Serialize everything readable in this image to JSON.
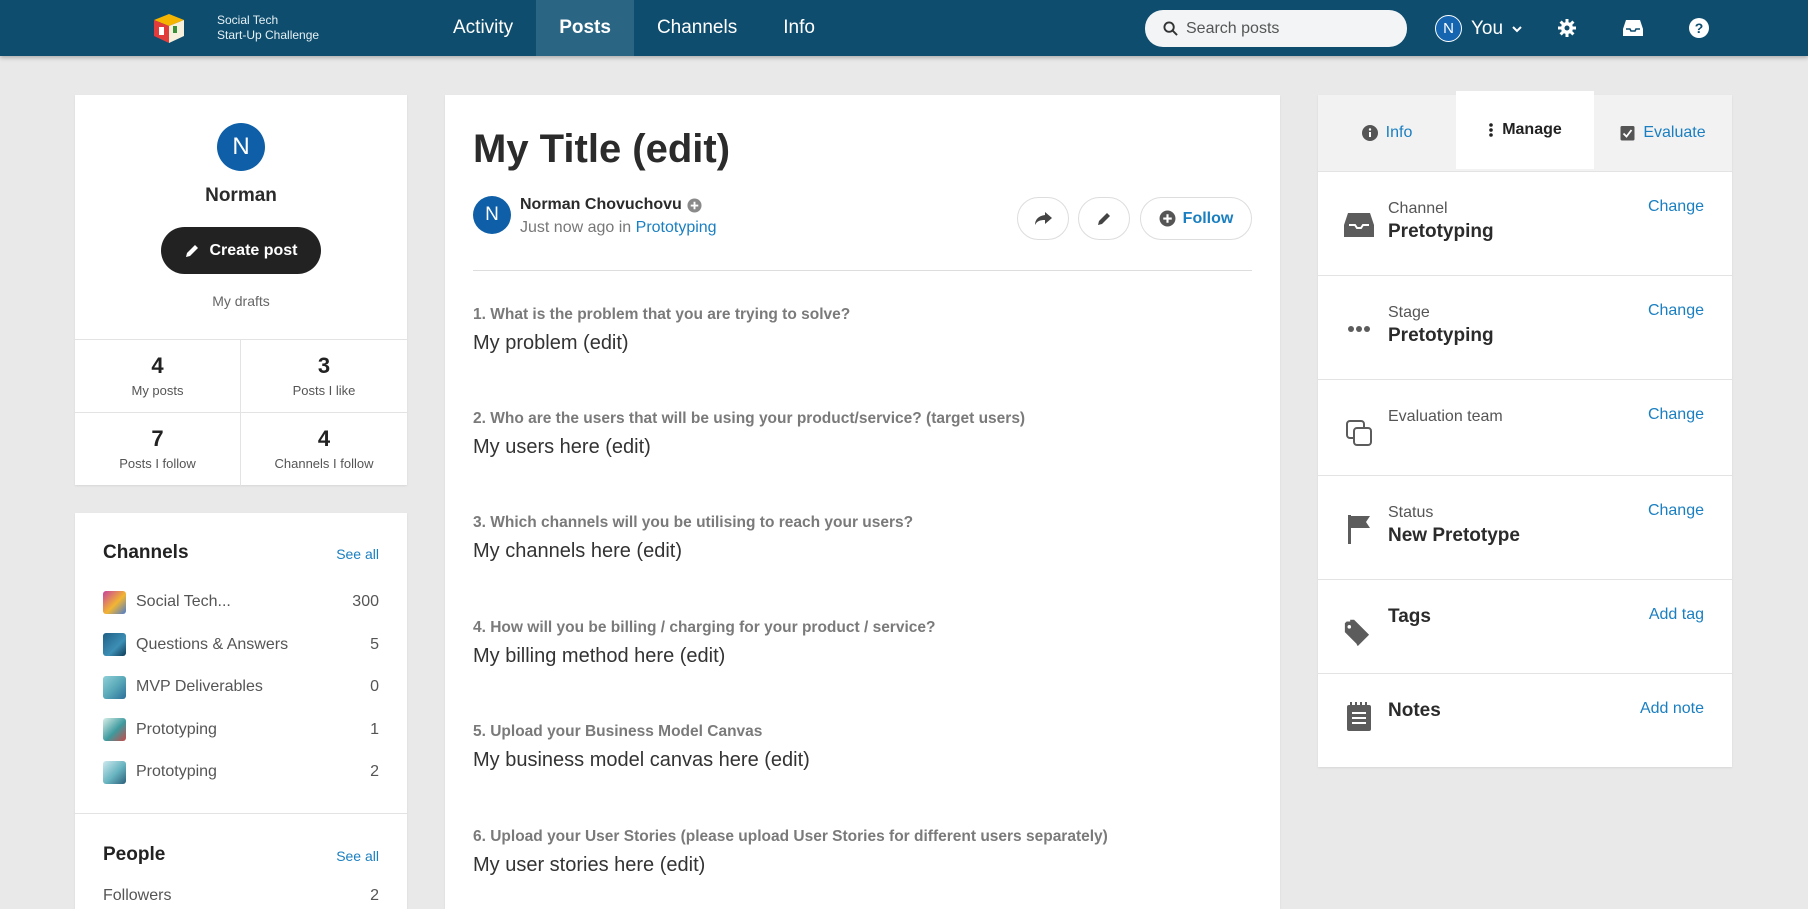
{
  "brand": {
    "line1": "Social Tech",
    "line2": "Start-Up Challenge"
  },
  "nav": [
    {
      "label": "Activity",
      "active": false
    },
    {
      "label": "Posts",
      "active": true
    },
    {
      "label": "Channels",
      "active": false
    },
    {
      "label": "Info",
      "active": false
    }
  ],
  "search": {
    "placeholder": "Search posts"
  },
  "user_menu": {
    "initial": "N",
    "label": "You"
  },
  "profile": {
    "initial": "N",
    "name": "Norman",
    "create_label": "Create post",
    "drafts_label": "My drafts",
    "stats": [
      {
        "value": "4",
        "label": "My posts"
      },
      {
        "value": "3",
        "label": "Posts I like"
      },
      {
        "value": "7",
        "label": "Posts I follow"
      },
      {
        "value": "4",
        "label": "Channels I follow"
      }
    ]
  },
  "channels": {
    "heading": "Channels",
    "see_all": "See all",
    "items": [
      {
        "name": "Social Tech...",
        "count": "300",
        "color": "#c83fa0"
      },
      {
        "name": "Questions & Answers",
        "count": "5",
        "color": "#1f5f86"
      },
      {
        "name": "MVP Deliverables",
        "count": "0",
        "color": "#5aa9b8"
      },
      {
        "name": "Prototyping",
        "count": "1",
        "color": "#3e9a9e"
      },
      {
        "name": "Prototyping",
        "count": "2",
        "color": "#67b3bf"
      }
    ]
  },
  "people": {
    "heading": "People",
    "see_all": "See all",
    "followers_label": "Followers",
    "followers_count": "2"
  },
  "post": {
    "title": "My Title (edit)",
    "author_initial": "N",
    "author": "Norman Chovuchovu",
    "time": "Just now ago",
    "in_label": "in",
    "channel": "Prototyping",
    "follow_label": "Follow",
    "sections": [
      {
        "q": "1. What is the problem that you are trying to solve?",
        "a": "My problem (edit)"
      },
      {
        "q": "2. Who are the users that will be using your product/service? (target users)",
        "a": "My users here (edit)"
      },
      {
        "q": "3. Which channels will you be utilising to reach your users?",
        "a": "My channels here (edit)"
      },
      {
        "q": "4. How will you be billing / charging for your product / service?",
        "a": "My billing method here (edit)"
      },
      {
        "q": "5. Upload your Business Model Canvas",
        "a": "My business model canvas here (edit)"
      },
      {
        "q": "6. Upload your User Stories (please upload User Stories for different users separately)",
        "a": "My user stories here (edit)"
      }
    ]
  },
  "manage": {
    "tabs": [
      {
        "label": "Info",
        "active": false
      },
      {
        "label": "Manage",
        "active": true
      },
      {
        "label": "Evaluate",
        "active": false
      }
    ],
    "channel": {
      "label": "Channel",
      "value": "Pretotyping",
      "action": "Change"
    },
    "stage": {
      "label": "Stage",
      "value": "Pretotyping",
      "action": "Change"
    },
    "evaluation": {
      "label": "Evaluation team",
      "action": "Change"
    },
    "status": {
      "label": "Status",
      "value": "New Pretotype",
      "action": "Change"
    },
    "tags": {
      "title": "Tags",
      "action": "Add tag"
    },
    "notes": {
      "title": "Notes",
      "action": "Add note"
    }
  },
  "colors": {
    "topbar": "#0e4d6e",
    "accent": "#1a7fc1",
    "avatar": "#0e5fa8"
  }
}
